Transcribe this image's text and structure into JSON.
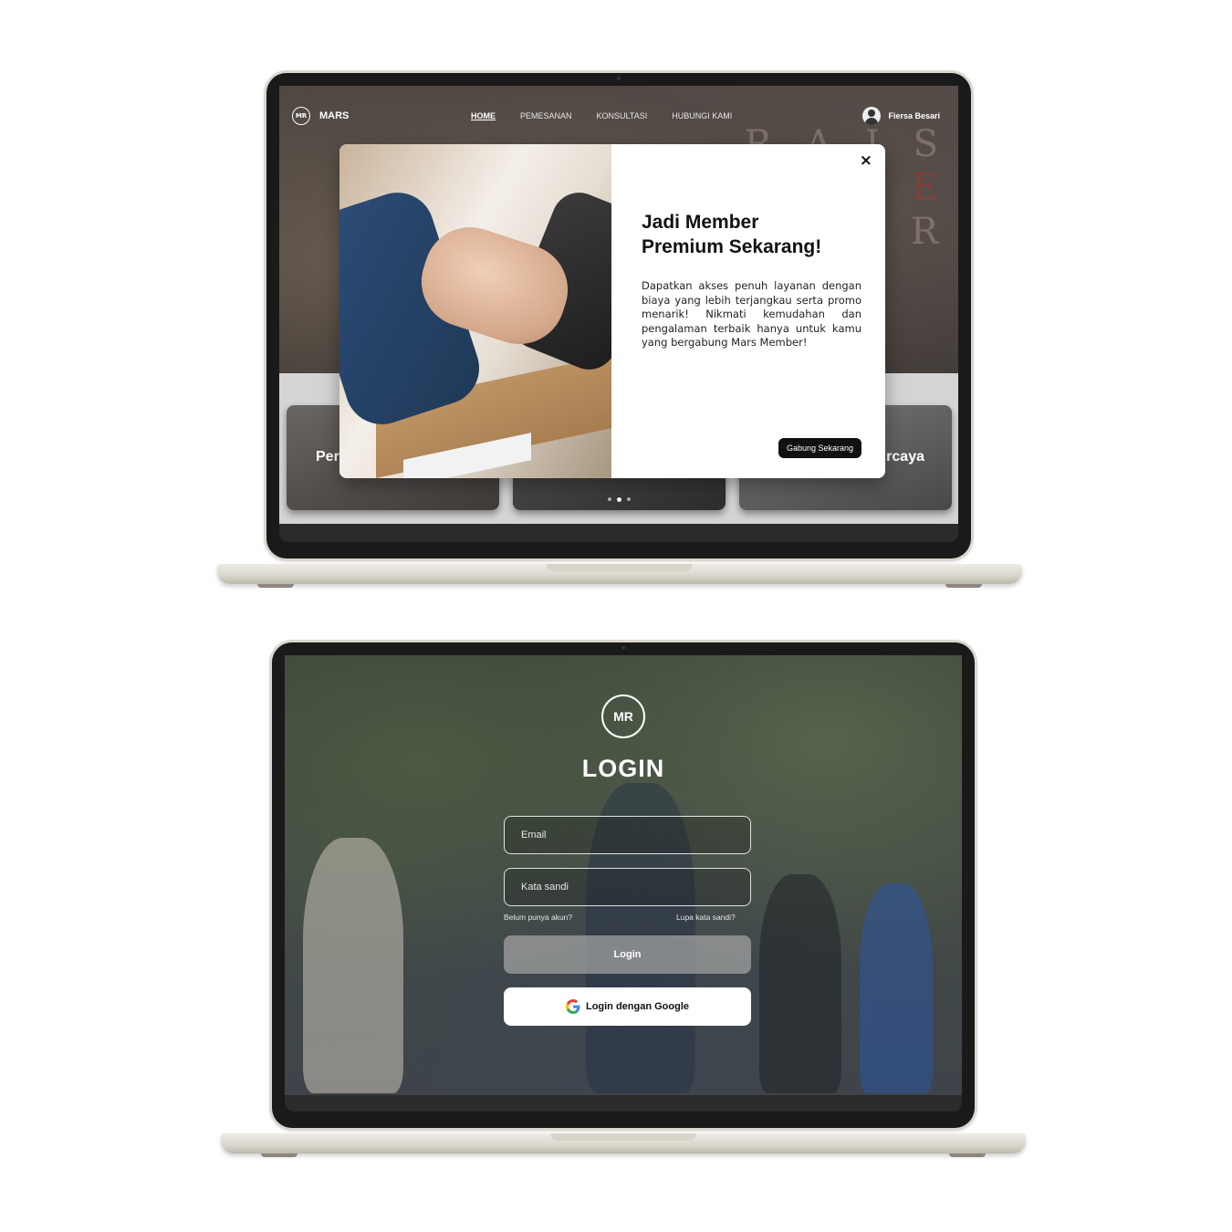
{
  "home": {
    "brand": "MARS",
    "nav": [
      "HOME",
      "PEMESANAN",
      "KONSULTASI",
      "HUBUNGI KAMI"
    ],
    "user_name": "Fiersa Besari",
    "cards": [
      "Per",
      "",
      "rcaya"
    ],
    "carousel": {
      "slides": 3,
      "active": 2
    },
    "modal": {
      "close": "×",
      "title_line1": "Jadi Member",
      "title_line2": "Premium Sekarang!",
      "body": "Dapatkan akses penuh layanan dengan biaya yang lebih terjangkau serta promo menarik! Nikmati kemudahan dan pengalaman terbaik hanya untuk kamu yang bergabung Mars Member!",
      "cta": "Gabung Sekarang"
    }
  },
  "login": {
    "title": "LOGIN",
    "email_placeholder": "Email",
    "password_placeholder": "Kata sandi",
    "register_link": "Belum punya akun?",
    "forgot_link": "Lupa kata sandi?",
    "login_button": "Login",
    "google_button": "Login dengan Google"
  },
  "colors": {
    "modal_bg": "#ffffff",
    "cta_bg": "#111111",
    "login_btn": "#a0a0a0"
  }
}
